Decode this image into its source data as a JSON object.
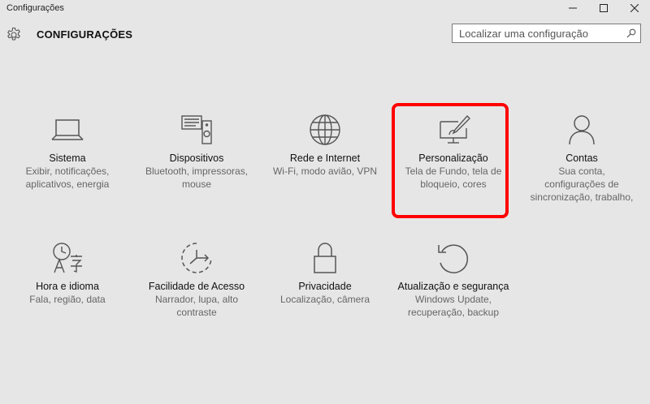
{
  "window": {
    "title": "Configurações"
  },
  "header": {
    "heading": "CONFIGURAÇÕES"
  },
  "search": {
    "placeholder": "Localizar uma configuração"
  },
  "tiles": [
    {
      "name": "Sistema",
      "desc1": "Exibir, notificações,",
      "desc2": "aplicativos, energia",
      "desc3": ""
    },
    {
      "name": "Dispositivos",
      "desc1": "Bluetooth, impressoras,",
      "desc2": "mouse",
      "desc3": ""
    },
    {
      "name": "Rede e Internet",
      "desc1": "Wi-Fi, modo avião, VPN",
      "desc2": "",
      "desc3": ""
    },
    {
      "name": "Personalização",
      "desc1": "Tela de Fundo, tela de",
      "desc2": "bloqueio, cores",
      "desc3": ""
    },
    {
      "name": "Contas",
      "desc1": "Sua conta,",
      "desc2": "configurações de",
      "desc3": "sincronização, trabalho,"
    },
    {
      "name": "Hora e idioma",
      "desc1": "Fala, região, data",
      "desc2": "",
      "desc3": ""
    },
    {
      "name": "Facilidade de Acesso",
      "desc1": "Narrador, lupa, alto",
      "desc2": "contraste",
      "desc3": ""
    },
    {
      "name": "Privacidade",
      "desc1": "Localização, câmera",
      "desc2": "",
      "desc3": ""
    },
    {
      "name": "Atualização e segurança",
      "desc1": "Windows Update,",
      "desc2": "recuperação, backup",
      "desc3": ""
    }
  ],
  "icons": {
    "tiles": [
      "laptop-icon",
      "devices-icon",
      "globe-icon",
      "personalization-icon",
      "person-icon",
      "time-language-icon",
      "ease-of-access-icon",
      "lock-icon",
      "update-icon"
    ]
  },
  "colors": {
    "highlight": "#ff0000",
    "icon": "#555555"
  }
}
